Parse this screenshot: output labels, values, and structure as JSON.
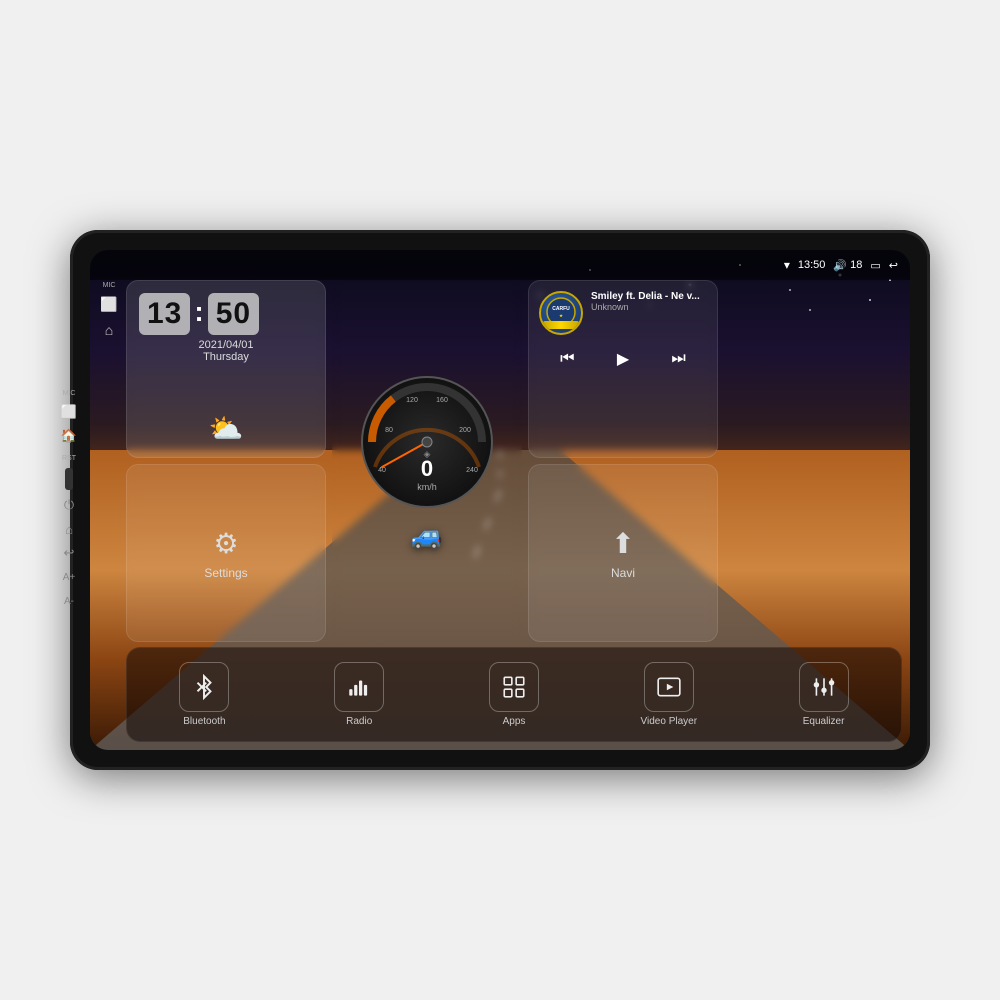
{
  "device": {
    "status_bar": {
      "wifi_icon": "▼",
      "time": "13:50",
      "volume_icon": "🔊",
      "volume_level": "18",
      "battery_icon": "🔋",
      "back_icon": "↩"
    },
    "side_buttons": {
      "mic_label": "MIC",
      "rst_label": "RST"
    },
    "clock": {
      "hours": "13",
      "minutes": "50",
      "date": "2021/04/01",
      "day": "Thursday",
      "weather_emoji": "⛅"
    },
    "speed": {
      "value": "0",
      "unit": "km/h"
    },
    "music": {
      "title": "Smiley ft. Delia - Ne v...",
      "artist": "Unknown",
      "logo_text": "CARFU",
      "prev": "⏮",
      "play": "▶",
      "next": "⏭"
    },
    "settings": {
      "icon": "⚙",
      "label": "Settings"
    },
    "navi": {
      "icon": "⬆",
      "label": "Navi"
    },
    "bottom_items": [
      {
        "id": "bluetooth",
        "icon": "bluetooth",
        "label": "Bluetooth"
      },
      {
        "id": "radio",
        "icon": "radio",
        "label": "Radio"
      },
      {
        "id": "apps",
        "icon": "apps",
        "label": "Apps"
      },
      {
        "id": "video",
        "icon": "video",
        "label": "Video Player"
      },
      {
        "id": "equalizer",
        "icon": "equalizer",
        "label": "Equalizer"
      }
    ]
  }
}
